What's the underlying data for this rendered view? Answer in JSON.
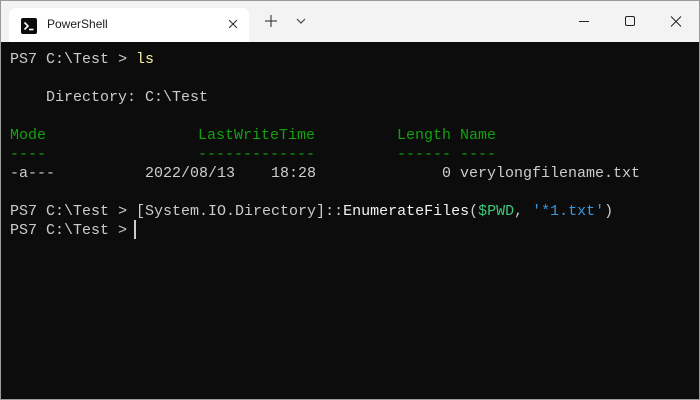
{
  "window": {
    "tab_title": "PowerShell",
    "icons": [
      "powershell-icon",
      "close-icon",
      "plus-icon",
      "chevron-down-icon",
      "minimize-icon",
      "maximize-icon",
      "close-window-icon"
    ]
  },
  "terminal": {
    "colors": {
      "background": "#0c0c0c",
      "text": "#cccccc",
      "header": "#13a10e",
      "command": "#f9f1a5",
      "variable": "#3fc67a",
      "string": "#3a96dd"
    },
    "line1": {
      "prompt": "PS7 C:\\Test > ",
      "command": "ls"
    },
    "directory_label": "    Directory: C:\\Test",
    "headers": {
      "mode": "Mode",
      "lastwritetime": "LastWriteTime",
      "length": "Length",
      "name": "Name"
    },
    "underlines": {
      "mode": "----",
      "lastwritetime": "-------------",
      "length": "------",
      "name": "----"
    },
    "file_row": {
      "mode": "-a---",
      "date": "2022/08/13",
      "time": "18:28",
      "length": "0",
      "name": "verylongfilename.txt"
    },
    "line2": {
      "prompt": "PS7 C:\\Test > ",
      "type": "[System.IO.Directory]",
      "op": "::",
      "method": "EnumerateFiles",
      "open": "(",
      "arg1": "$PWD",
      "comma": ", ",
      "arg2": "'*1.txt'",
      "close": ")"
    },
    "line3": {
      "prompt": "PS7 C:\\Test > "
    }
  }
}
